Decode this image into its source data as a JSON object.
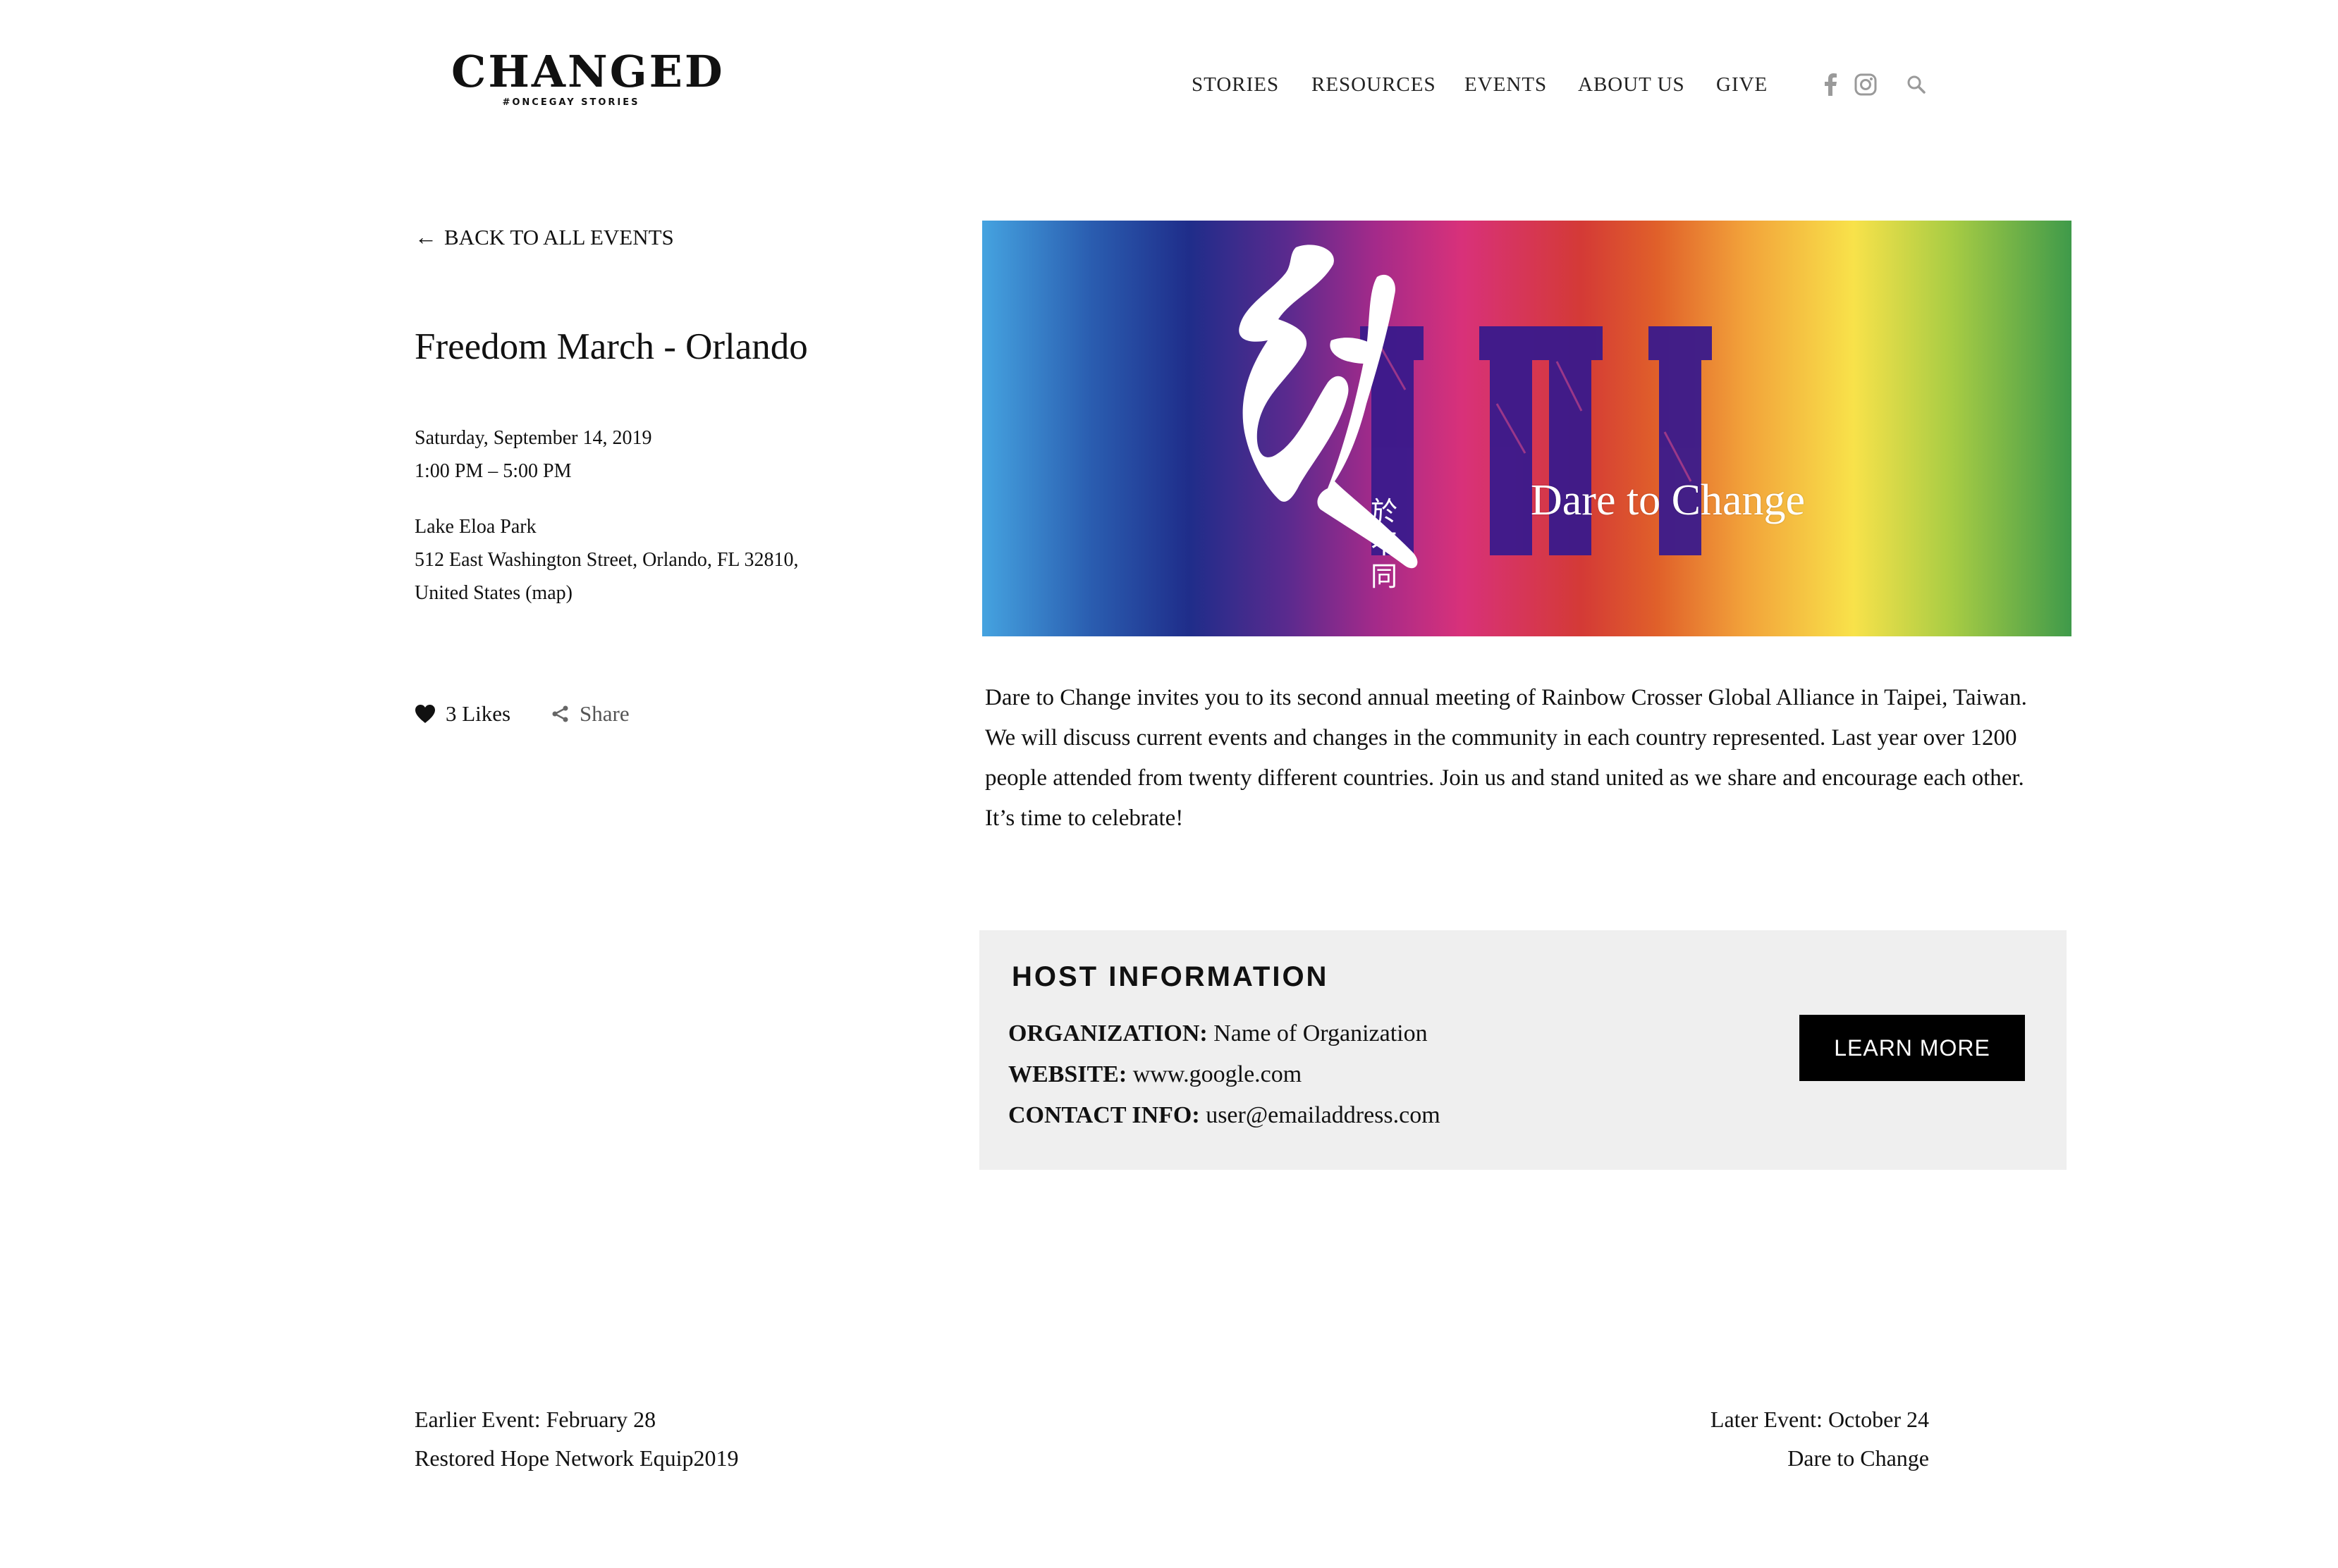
{
  "header": {
    "logo_main": "CHANGED",
    "logo_sub": "#ONCEGAY STORIES",
    "nav": [
      "STORIES",
      "RESOURCES",
      "EVENTS",
      "ABOUT US",
      "GIVE"
    ],
    "icons": [
      "facebook-icon",
      "instagram-icon",
      "search-icon"
    ]
  },
  "event": {
    "back_label": "BACK TO ALL EVENTS",
    "title": "Freedom March - Orlando",
    "date": "Saturday, September 14, 2019",
    "time": "1:00 PM – 5:00 PM",
    "venue": "Lake Eloa Park",
    "address_line1": "512 East Washington Street, Orlando, FL 32810,",
    "address_line2": "United States (map)",
    "likes": "3 Likes",
    "share": "Share"
  },
  "banner": {
    "numerals": "1111",
    "caption": "Dare to Change",
    "cjk_main": "敢",
    "cjk_vertical": [
      "於",
      "不",
      "同"
    ]
  },
  "description": "Dare to Change invites you to its second annual meeting of Rainbow Crosser Global Alliance in Taipei, Taiwan. We will discuss current events and changes in the community in each country represented. Last year over 1200 people attended from twenty different countries. Join us and stand united as we share and encourage each other. It’s time to celebrate!",
  "host": {
    "heading": "HOST INFORMATION",
    "org_label": "ORGANIZATION:",
    "org_value": "Name of Organization",
    "website_label": "WEBSITE:",
    "website_value": "www.google.com",
    "contact_label": "CONTACT INFO:",
    "contact_value": "user@emailaddress.com",
    "button": "LEARN MORE"
  },
  "pagination": {
    "earlier_label": "Earlier Event: February 28",
    "earlier_title": "Restored Hope Network Equip2019",
    "later_label": "Later Event: October 24",
    "later_title": "Dare to Change"
  },
  "colors": {
    "accent": "#000000",
    "host_bg": "#efefef",
    "icon_gray": "#9a9a9a"
  }
}
